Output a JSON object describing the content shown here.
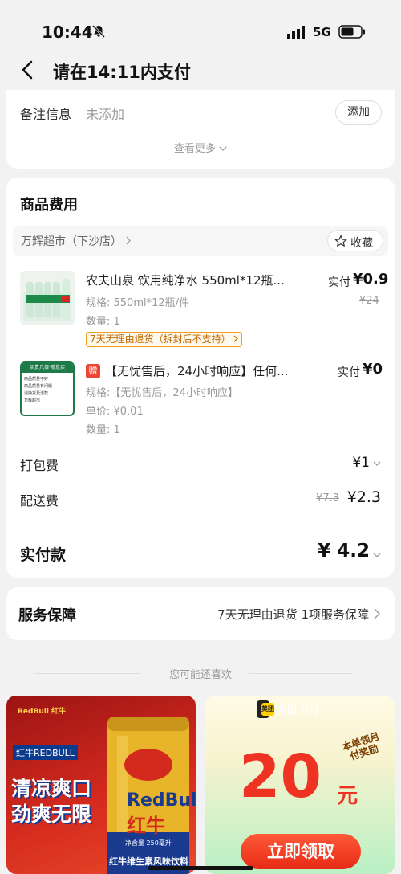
{
  "status_bar": {
    "time": "10:44",
    "network": "5G"
  },
  "nav": {
    "title": "请在14:11内支付"
  },
  "remark": {
    "label": "备注信息",
    "value": "未添加",
    "add_label": "添加",
    "more_label": "查看更多"
  },
  "goods": {
    "section_title": "商品费用",
    "store_name": "万辉超市（下沙店）",
    "collect_label": "收藏",
    "items": [
      {
        "name": "农夫山泉 饮用纯净水 550ml*12瓶...",
        "spec": "规格: 550ml*12瓶/件",
        "qty": "数量: 1",
        "price_label": "实付",
        "price": "¥0.9",
        "orig_price": "¥24",
        "tag": "7天无理由退货（拆封后不支持）"
      },
      {
        "gift_badge": "赠",
        "name": "【无忧售后，24小时响应】任何...",
        "spec": "规格:【无忧售后，24小时响应】",
        "unit_price": "单价: ¥0.01",
        "qty": "数量: 1",
        "price_label": "实付",
        "price": "¥0",
        "thumb_title": "买贵几倍·随意买",
        "thumb_lines": [
          "商品质量不好",
          "商品质量有问题",
          "退换货及退款",
          "万辉超市"
        ]
      }
    ],
    "packing": {
      "label": "打包费",
      "value": "¥1"
    },
    "delivery": {
      "label": "配送费",
      "orig": "¥7.3",
      "value": "¥2.3"
    },
    "total": {
      "label": "实付款",
      "value": "¥ 4.2"
    }
  },
  "service": {
    "label": "服务保障",
    "value": "7天无理由退货 1项服务保障"
  },
  "recommend": {
    "title": "您可能还喜欢"
  },
  "banner_redbull": {
    "brand": "RedBull 红牛",
    "tagline": "红牛REDBULL",
    "slogan1": "清凉爽口",
    "slogan2": "劲爽无限",
    "can_brand": "RedBull",
    "can_cn": "红牛",
    "can_sub": "红牛维生素风味饮料",
    "can_volume": "净含量 250毫升"
  },
  "banner_meituan": {
    "logo": "美团",
    "badge": "美团·月付",
    "reward": "本单领月付奖励",
    "amount": "20",
    "unit": "元",
    "cta": "立即领取"
  },
  "colors": {
    "accent_red": "#ee3322",
    "tag_orange": "#f0a020"
  }
}
